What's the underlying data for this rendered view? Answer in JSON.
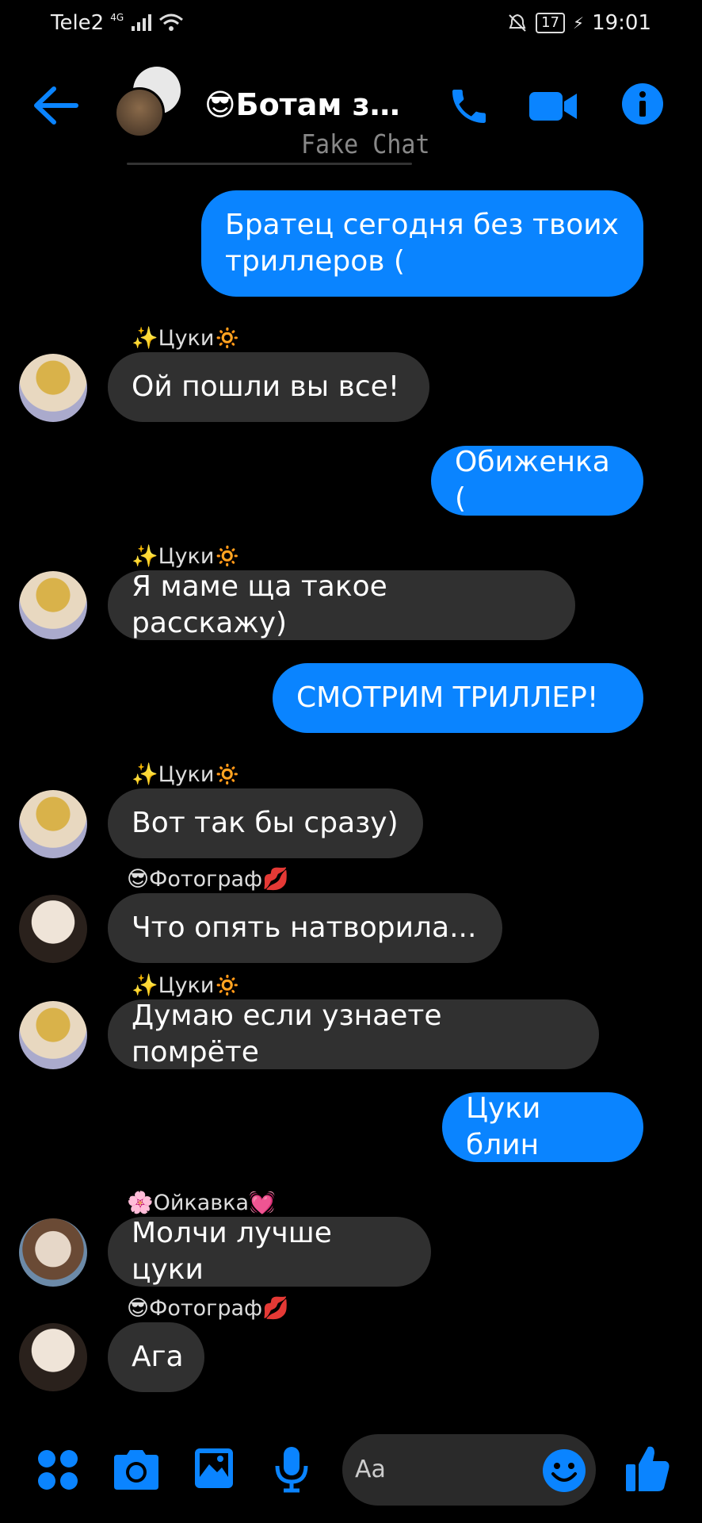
{
  "status": {
    "carrier": "Tele2",
    "network": "4G",
    "battery": "17",
    "time": "19:01"
  },
  "header": {
    "title": "😎Ботам зде…",
    "watermark": "Fake Chat"
  },
  "messages": [
    {
      "dir": "out",
      "text": "Братец сегодня без твоих триллеров ("
    },
    {
      "dir": "in",
      "sender": "✨Цуки🔅",
      "text": "Ой пошли вы все!"
    },
    {
      "dir": "out",
      "text": "Обиженка ("
    },
    {
      "dir": "in",
      "sender": "✨Цуки🔅",
      "text": "Я маме ща такое расскажу)"
    },
    {
      "dir": "out",
      "text": "СМОТРИМ ТРИЛЛЕР!"
    },
    {
      "dir": "in",
      "sender": "✨Цуки🔅",
      "text": "Вот так бы сразу)"
    },
    {
      "dir": "in",
      "sender": "😎Фотограф💋",
      "text": "Что опять натворила..."
    },
    {
      "dir": "in",
      "sender": "✨Цуки🔅",
      "text": "Думаю если узнаете помрёте"
    },
    {
      "dir": "out",
      "text": "Цуки блин"
    },
    {
      "dir": "in",
      "sender": "🌸Ойкавка💓",
      "text": "Молчи лучше цуки"
    },
    {
      "dir": "in",
      "sender": "😎Фотограф💋",
      "text": "Ага"
    }
  ],
  "composer": {
    "placeholder": "Aa"
  },
  "colors": {
    "accent": "#0a84ff",
    "incoming_bubble": "#303030",
    "background": "#000000"
  }
}
